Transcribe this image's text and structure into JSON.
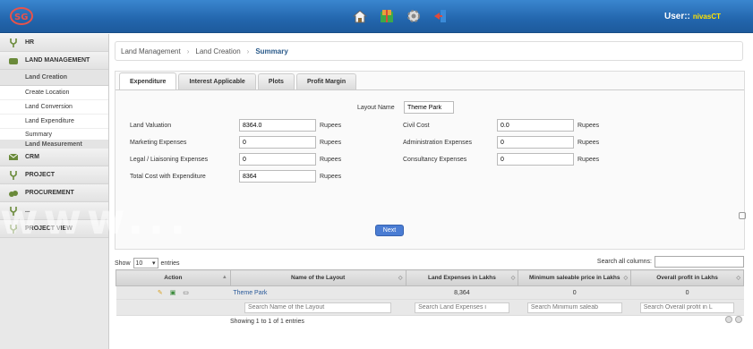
{
  "header": {
    "user_label": "User::",
    "user_name": "nivasCT",
    "icons": [
      "home-icon",
      "gift-icon",
      "gear-icon",
      "logout-icon"
    ]
  },
  "sidebar": {
    "items": [
      {
        "label": "HR",
        "icon": "hr-icon"
      },
      {
        "label": "LAND MANAGEMENT",
        "icon": "land-icon"
      }
    ],
    "sub_header": "Land Creation",
    "sub_items": [
      "Create Location",
      "Land Conversion",
      "Land Expenditure",
      "Summary"
    ],
    "sub_header2": "Land Measurement",
    "items_after": [
      {
        "label": "CRM",
        "icon": "crm-icon"
      },
      {
        "label": "PROJECT",
        "icon": "project-icon"
      },
      {
        "label": "PROCUREMENT",
        "icon": "procurement-icon"
      },
      {
        "label": "...",
        "icon": "misc-icon"
      },
      {
        "label": "PROJECT VIEW",
        "icon": "view-icon"
      }
    ]
  },
  "breadcrumb": [
    "Land Management",
    "Land Creation",
    "Summary"
  ],
  "tabs": [
    "Expenditure",
    "Interest Applicable",
    "Plots",
    "Profit Margin"
  ],
  "form": {
    "layout_label": "Layout Name",
    "layout_value": "Theme Park",
    "land_valuation_label": "Land Valuation",
    "land_valuation": "8364.0",
    "marketing_label": "Marketing Expenses",
    "marketing": "0",
    "legal_label": "Legal / Liaisoning Expenses",
    "legal": "0",
    "total_label": "Total Cost with Expenditure",
    "total": "8364",
    "civil_label": "Civil Cost",
    "civil": "0.0",
    "admin_label": "Administration Expenses",
    "admin": "0",
    "consult_label": "Consultancy Expenses",
    "consult": "0",
    "unit": "Rupees",
    "next": "Next"
  },
  "watermark": "www...",
  "list": {
    "show": "Show",
    "entries_value": "10",
    "entries": "entries",
    "search_all": "Search all columns:",
    "showing": "Showing 1 to 1 of 1 entries"
  },
  "table": {
    "headers": [
      "Action",
      "Name of the Layout",
      "Land Expenses in Lakhs",
      "Minimum saleable price in Lakhs",
      "Overall profit in Lakhs"
    ],
    "row": [
      "",
      "Theme Park",
      "8,364",
      "0",
      "0"
    ],
    "filters": [
      "Search Name of the Layout",
      "Search Land Expenses i",
      "Search Minimum saleab",
      "Search Overall profit in L"
    ]
  }
}
